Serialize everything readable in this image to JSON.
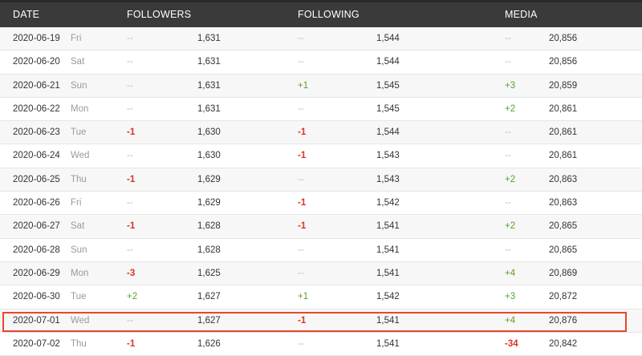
{
  "header": {
    "date": "DATE",
    "followers": "FOLLOWERS",
    "following": "FOLLOWING",
    "media": "MEDIA"
  },
  "rows": [
    {
      "date": "2020-06-19",
      "day": "Fri",
      "followers_change": "--",
      "followers": "1,631",
      "following_change": "--",
      "following": "1,544",
      "media_change": "--",
      "media": "20,856"
    },
    {
      "date": "2020-06-20",
      "day": "Sat",
      "followers_change": "--",
      "followers": "1,631",
      "following_change": "--",
      "following": "1,544",
      "media_change": "--",
      "media": "20,856"
    },
    {
      "date": "2020-06-21",
      "day": "Sun",
      "followers_change": "--",
      "followers": "1,631",
      "following_change": "+1",
      "following": "1,545",
      "media_change": "+3",
      "media": "20,859"
    },
    {
      "date": "2020-06-22",
      "day": "Mon",
      "followers_change": "--",
      "followers": "1,631",
      "following_change": "--",
      "following": "1,545",
      "media_change": "+2",
      "media": "20,861"
    },
    {
      "date": "2020-06-23",
      "day": "Tue",
      "followers_change": "-1",
      "followers": "1,630",
      "following_change": "-1",
      "following": "1,544",
      "media_change": "--",
      "media": "20,861"
    },
    {
      "date": "2020-06-24",
      "day": "Wed",
      "followers_change": "--",
      "followers": "1,630",
      "following_change": "-1",
      "following": "1,543",
      "media_change": "--",
      "media": "20,861"
    },
    {
      "date": "2020-06-25",
      "day": "Thu",
      "followers_change": "-1",
      "followers": "1,629",
      "following_change": "--",
      "following": "1,543",
      "media_change": "+2",
      "media": "20,863"
    },
    {
      "date": "2020-06-26",
      "day": "Fri",
      "followers_change": "--",
      "followers": "1,629",
      "following_change": "-1",
      "following": "1,542",
      "media_change": "--",
      "media": "20,863"
    },
    {
      "date": "2020-06-27",
      "day": "Sat",
      "followers_change": "-1",
      "followers": "1,628",
      "following_change": "-1",
      "following": "1,541",
      "media_change": "+2",
      "media": "20,865"
    },
    {
      "date": "2020-06-28",
      "day": "Sun",
      "followers_change": "--",
      "followers": "1,628",
      "following_change": "--",
      "following": "1,541",
      "media_change": "--",
      "media": "20,865"
    },
    {
      "date": "2020-06-29",
      "day": "Mon",
      "followers_change": "-3",
      "followers": "1,625",
      "following_change": "--",
      "following": "1,541",
      "media_change": "+4",
      "media": "20,869"
    },
    {
      "date": "2020-06-30",
      "day": "Tue",
      "followers_change": "+2",
      "followers": "1,627",
      "following_change": "+1",
      "following": "1,542",
      "media_change": "+3",
      "media": "20,872"
    },
    {
      "date": "2020-07-01",
      "day": "Wed",
      "followers_change": "--",
      "followers": "1,627",
      "following_change": "-1",
      "following": "1,541",
      "media_change": "+4",
      "media": "20,876"
    },
    {
      "date": "2020-07-02",
      "day": "Thu",
      "followers_change": "-1",
      "followers": "1,626",
      "following_change": "--",
      "following": "1,541",
      "media_change": "-34",
      "media": "20,842"
    }
  ],
  "colors": {
    "header_bg": "#3a3a3a",
    "positive": "#5aa02c",
    "negative": "#d9341e",
    "highlight_border": "#e8462e"
  }
}
